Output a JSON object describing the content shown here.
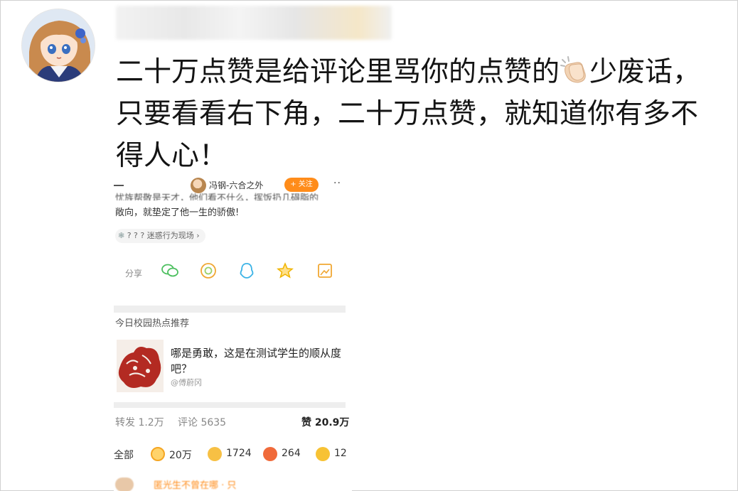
{
  "post": {
    "author_name": "",
    "text_lines": [
      "二十万点赞是给评论里骂你的点赞的",
      "少废话，",
      "只要看看右下角，二十万点赞，就知道你有多不",
      "得人心！"
    ],
    "emoji": "clapping-hands-icon"
  },
  "embedded": {
    "author": "冯钢-六合之外",
    "follow_label": "+ 关注",
    "more": "··",
    "cut_line1": "忧族帮敬是天才，他们看不什么，挥饭扔几碍脂的",
    "cut_line2": "敞向，就垫定了他一生的骄傲!",
    "topic": "? ? ? 迷惑行为现场 ›",
    "share_label": "分享",
    "share_icons": [
      "wechat-icon",
      "moments-icon",
      "qq-icon",
      "favorite-star-icon",
      "image-save-icon"
    ],
    "hot_title": "今日校园热点推荐",
    "card_title": "哪是勇敢，这是在测试学生的顺从度吧？",
    "card_source": "@傅蔚冈",
    "repost": "转发 1.2万",
    "comments": "评论 5635",
    "likes": "赞 20.9万",
    "reactions_all": "全部",
    "reactions": [
      {
        "icon": "like-smile-icon",
        "count": "20万",
        "color": "#f5a623"
      },
      {
        "icon": "thumbs-up-icon",
        "count": "1724",
        "color": "#f5b02a"
      },
      {
        "icon": "angry-face-icon",
        "count": "264",
        "color": "#f06a3a"
      },
      {
        "icon": "laugh-face-icon",
        "count": "12",
        "color": "#f7c234"
      }
    ],
    "next_comment": "匿光生不曾在哪 · 只"
  },
  "colors": {
    "accent_orange": "#ff8c1a",
    "text": "#141414"
  }
}
